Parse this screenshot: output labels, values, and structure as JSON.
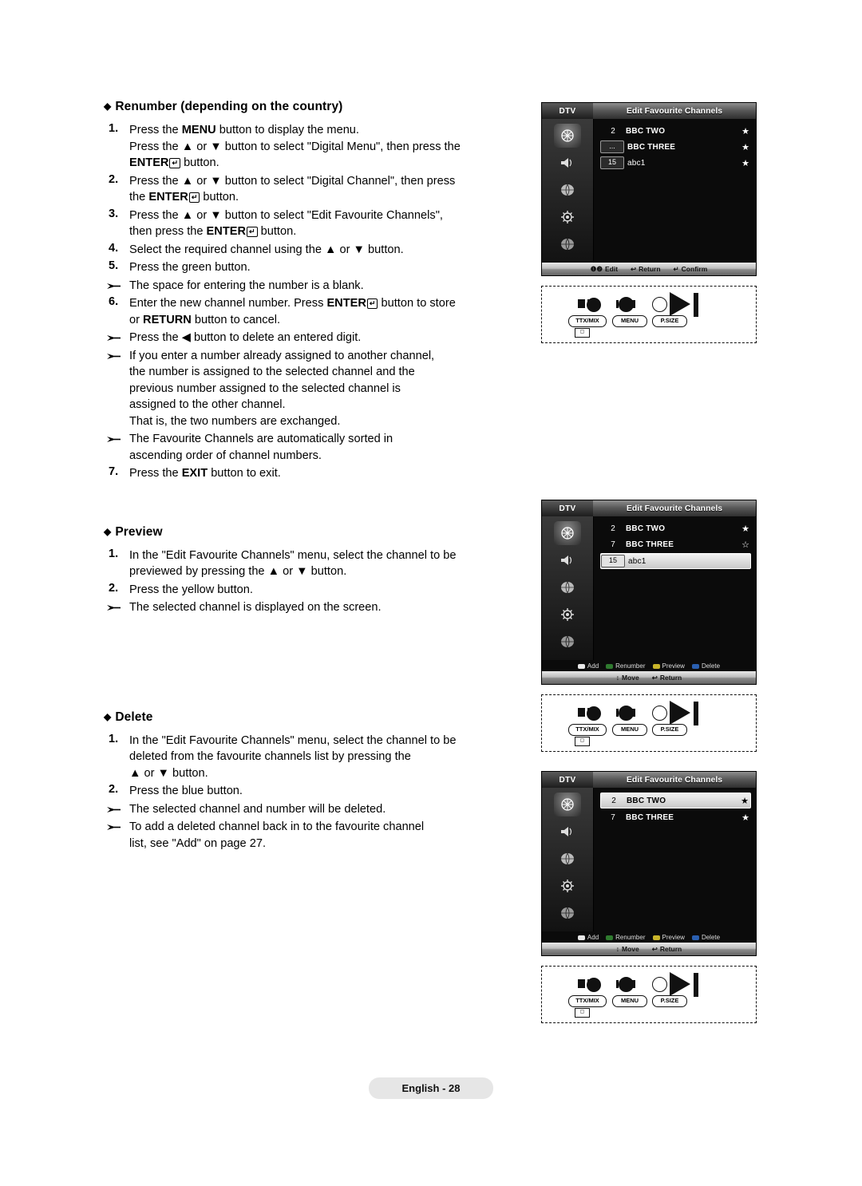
{
  "doc": {
    "footer_label": "English - 28"
  },
  "sections": [
    {
      "heading": "Renumber (depending on the country)",
      "steps": [
        {
          "num": "1.",
          "lines": [
            "Press the MENU button to display the menu.",
            "Press the ▲ or ▼ button to select \"Digital Menu\", then press the ENTER↵ button."
          ]
        },
        {
          "num": "2.",
          "lines": [
            "Press the ▲ or ▼ button to select \"Digital Channel\", then press the ENTER↵ button."
          ]
        },
        {
          "num": "3.",
          "lines": [
            "Press the ▲ or ▼ button to select \"Edit Favourite Channels\", then press the ENTER↵ button."
          ]
        },
        {
          "num": "4.",
          "lines": [
            "Select the required channel using the ▲ or ▼ button."
          ]
        },
        {
          "num": "5.",
          "lines": [
            "Press the green button."
          ]
        },
        {
          "num": "➢",
          "lines": [
            "The space for entering the number is a blank."
          ]
        },
        {
          "num": "6.",
          "lines": [
            "Enter the new channel number. Press ENTER↵ button to store or RETURN button to cancel."
          ]
        },
        {
          "num": "➢",
          "lines": [
            "Press the ◀ button to delete an entered digit."
          ]
        },
        {
          "num": "➢",
          "lines": [
            "If you enter a number already assigned to another channel, the number is assigned to the selected channel and the previous number assigned to the selected channel is assigned to the other channel.",
            "That is, the two numbers are exchanged."
          ]
        },
        {
          "num": "➢",
          "lines": [
            "The Favourite Channels are automatically sorted in ascending order of channel numbers."
          ]
        },
        {
          "num": "7.",
          "lines": [
            "Press the EXIT button to exit."
          ]
        }
      ]
    },
    {
      "heading": "Preview",
      "steps": [
        {
          "num": "1.",
          "lines": [
            "In the \"Edit Favourite Channels\" menu, select the channel to be previewed by pressing the ▲ or ▼ button."
          ]
        },
        {
          "num": "2.",
          "lines": [
            "Press the yellow button."
          ]
        },
        {
          "num": "➢",
          "lines": [
            "The selected channel is displayed on the screen."
          ]
        }
      ]
    },
    {
      "heading": "Delete",
      "steps": [
        {
          "num": "1.",
          "lines": [
            "In the \"Edit Favourite Channels\" menu, select the channel to be deleted from the favourite channels list by pressing the ▲ or ▼ button."
          ]
        },
        {
          "num": "2.",
          "lines": [
            "Press the blue button."
          ]
        },
        {
          "num": "➢",
          "lines": [
            "The selected channel and number will be deleted."
          ]
        },
        {
          "num": "➢",
          "lines": [
            "To add a deleted channel back in to the favourite channel list, see \"Add\" on page 27."
          ]
        }
      ]
    }
  ],
  "text": {
    "p1_s1_l1_a": "Press the ",
    "p1_s1_l1_menu": "MENU",
    "p1_s1_l1_b": " button to display the menu.",
    "p1_s1_l2_a": "Press the ▲ or ▼ button to select \"Digital Menu\", then press the",
    "p1_s1_l3_a": "ENTER",
    "p1_s1_l3_b": " button.",
    "p1_s2_l1": "Press the ▲ or ▼ button to select \"Digital Channel\", then press",
    "p1_s2_l2_a": "the ",
    "p1_s2_l2_b": "ENTER",
    "p1_s2_l2_c": " button.",
    "p1_s3_l1": "Press the ▲ or ▼ button to select \"Edit Favourite Channels\",",
    "p1_s3_l2_a": "then press the ",
    "p1_s3_l2_b": "ENTER",
    "p1_s3_l2_c": " button.",
    "p1_s4": "Select the required channel using the ▲ or ▼ button.",
    "p1_s5": "Press the green button.",
    "p1_b1": "The space for entering the number is a blank.",
    "p1_s6_l1_a": "Enter the new channel number. Press ",
    "p1_s6_l1_b": "ENTER",
    "p1_s6_l1_c": " button to store",
    "p1_s6_l2_a": "or ",
    "p1_s6_l2_b": "RETURN",
    "p1_s6_l2_c": " button to cancel.",
    "p1_b2": "Press the ◀ button to delete an entered digit.",
    "p1_b3_l1": "If you enter a number already assigned to another channel,",
    "p1_b3_l2": "the number is assigned to the selected channel and the",
    "p1_b3_l3": "previous number assigned to the selected channel is",
    "p1_b3_l4": "assigned to the other channel.",
    "p1_b3_l5": "That is, the two numbers are exchanged.",
    "p1_b4_l1": "The Favourite Channels are automatically sorted in",
    "p1_b4_l2": "ascending order of channel numbers.",
    "p1_s7_a": "Press the ",
    "p1_s7_b": "EXIT",
    "p1_s7_c": " button to exit.",
    "p2_s1_l1": "In the \"Edit Favourite Channels\" menu, select the channel to be",
    "p2_s1_l2": "previewed by pressing the ▲ or ▼ button.",
    "p2_s2": "Press the yellow button.",
    "p2_b1": "The selected channel is displayed on the screen.",
    "p3_s1_l1": "In the \"Edit Favourite Channels\" menu, select the channel to be",
    "p3_s1_l2": "deleted from the favourite channels list by pressing the",
    "p3_s1_l3": "▲ or ▼ button.",
    "p3_s2": "Press the blue button.",
    "p3_b1": "The selected channel and number will be deleted.",
    "p3_b2_l1": "To add a deleted channel back in to the favourite channel",
    "p3_b2_l2": "list, see \"Add\" on page 27."
  },
  "headings": {
    "renumber": "Renumber (depending on the country)",
    "preview": "Preview",
    "delete": "Delete"
  },
  "osd1": {
    "dtv": "DTV",
    "title": "Edit Favourite Channels",
    "rows": [
      {
        "no": "2",
        "name": "BBC TWO",
        "star": "★",
        "boxed": false,
        "highlight": false
      },
      {
        "no": "...",
        "name": "BBC THREE",
        "star": "★",
        "boxed": true,
        "highlight": false
      },
      {
        "no": "15",
        "name": "abc1",
        "star": "★",
        "boxed": true,
        "highlight": false
      }
    ],
    "foot": [
      {
        "icon": "❶❷",
        "label": "Edit"
      },
      {
        "icon": "↩",
        "label": "Return"
      },
      {
        "icon": "↵",
        "label": "Confirm"
      }
    ]
  },
  "osd2": {
    "dtv": "DTV",
    "title": "Edit Favourite Channels",
    "rows": [
      {
        "no": "2",
        "name": "BBC TWO",
        "star": "★",
        "boxed": false,
        "highlight": false
      },
      {
        "no": "7",
        "name": "BBC THREE",
        "star": "☆",
        "boxed": false,
        "highlight": false
      },
      {
        "no": "15",
        "name": "abc1",
        "star": "",
        "boxed": true,
        "highlight": true
      }
    ],
    "colorbar": [
      {
        "color": "#e8e8e8",
        "label": "Add"
      },
      {
        "color": "#2f7a2f",
        "label": "Renumber"
      },
      {
        "color": "#c9b52a",
        "label": "Preview"
      },
      {
        "color": "#2a5fb0",
        "label": "Delete"
      }
    ],
    "foot": [
      {
        "icon": "↕",
        "label": "Move"
      },
      {
        "icon": "↩",
        "label": "Return"
      }
    ]
  },
  "osd3": {
    "dtv": "DTV",
    "title": "Edit Favourite Channels",
    "rows": [
      {
        "no": "2",
        "name": "BBC TWO",
        "star": "★",
        "boxed": false,
        "highlight": true
      },
      {
        "no": "7",
        "name": "BBC THREE",
        "star": "★",
        "boxed": false,
        "highlight": false
      }
    ],
    "colorbar": [
      {
        "color": "#e8e8e8",
        "label": "Add"
      },
      {
        "color": "#2f7a2f",
        "label": "Renumber"
      },
      {
        "color": "#c9b52a",
        "label": "Preview"
      },
      {
        "color": "#2a5fb0",
        "label": "Delete"
      }
    ],
    "foot": [
      {
        "icon": "↕",
        "label": "Move"
      },
      {
        "icon": "↩",
        "label": "Return"
      }
    ]
  },
  "remote": {
    "ttxmix": "TTX/MIX",
    "menu": "MENU",
    "psize": "P.SIZE"
  }
}
